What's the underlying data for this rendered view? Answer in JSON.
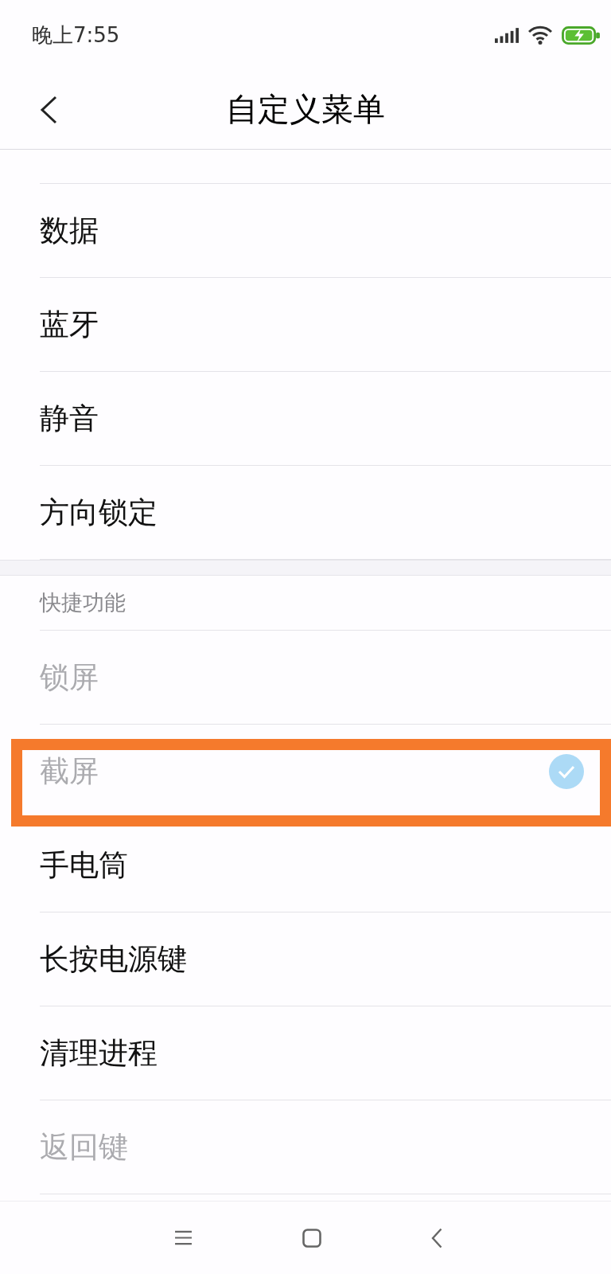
{
  "status_bar": {
    "time": "晚上7:55"
  },
  "header": {
    "title": "自定义菜单"
  },
  "sections": [
    {
      "items": [
        {
          "label": "数据",
          "disabled": false,
          "checked": false,
          "highlighted": false
        },
        {
          "label": "蓝牙",
          "disabled": false,
          "checked": false,
          "highlighted": false
        },
        {
          "label": "静音",
          "disabled": false,
          "checked": false,
          "highlighted": false
        },
        {
          "label": "方向锁定",
          "disabled": false,
          "checked": false,
          "highlighted": false
        }
      ]
    },
    {
      "heading": "快捷功能",
      "items": [
        {
          "label": "锁屏",
          "disabled": true,
          "checked": false,
          "highlighted": false
        },
        {
          "label": "截屏",
          "disabled": true,
          "checked": true,
          "highlighted": true
        },
        {
          "label": "手电筒",
          "disabled": false,
          "checked": false,
          "highlighted": false
        },
        {
          "label": "长按电源键",
          "disabled": false,
          "checked": false,
          "highlighted": false
        },
        {
          "label": "清理进程",
          "disabled": false,
          "checked": false,
          "highlighted": false
        },
        {
          "label": "返回键",
          "disabled": true,
          "checked": false,
          "highlighted": false
        }
      ]
    }
  ]
}
